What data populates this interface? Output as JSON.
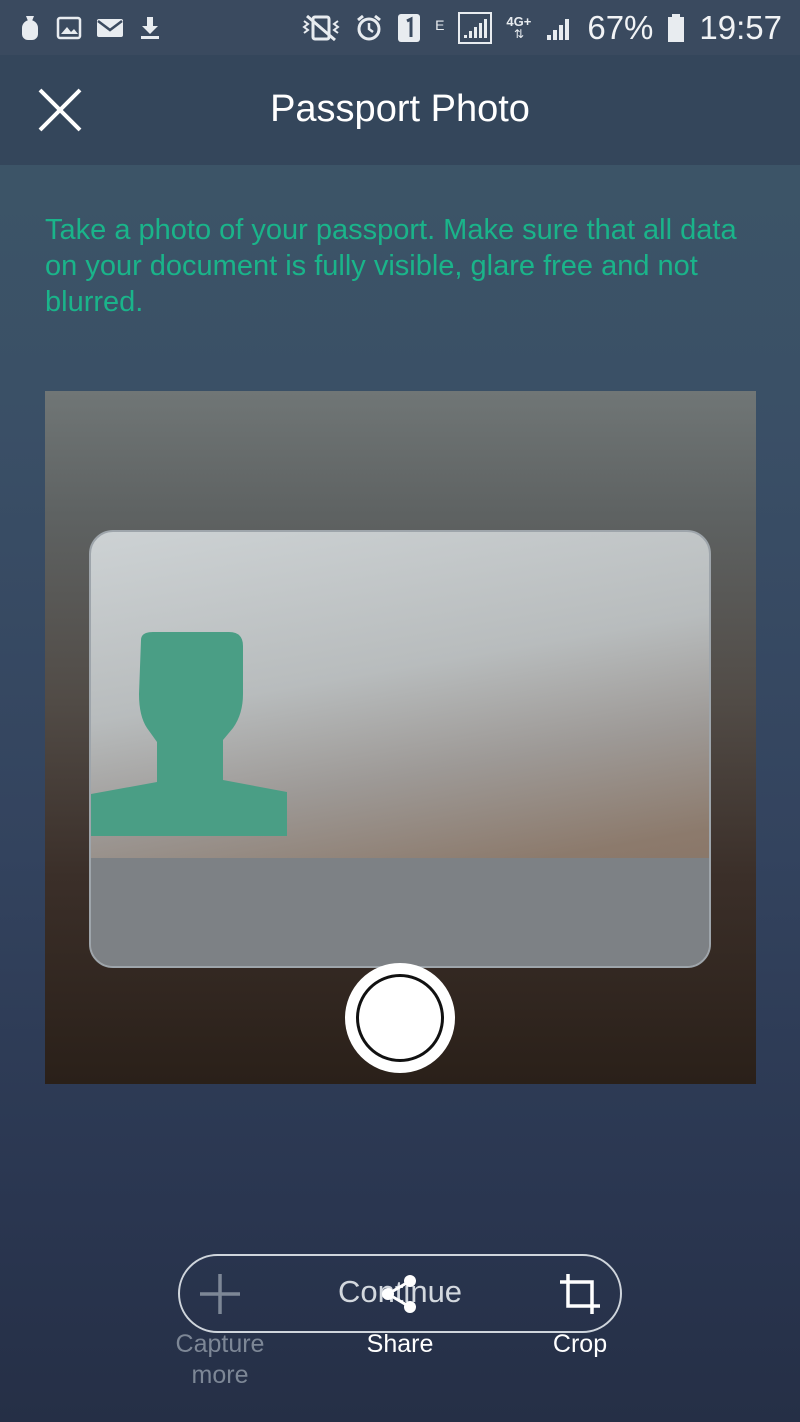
{
  "status_bar": {
    "battery": "67%",
    "time": "19:57",
    "network_e": "E",
    "network_4g": "4G+"
  },
  "header": {
    "title": "Passport Photo"
  },
  "instructions": "Take a photo of your passport. Make sure that all data on your document is fully visible, glare free and not blurred.",
  "actions": {
    "continue_label": "Continue",
    "capture_more_line1": "Capture",
    "capture_more_line2": "more",
    "share_label": "Share",
    "crop_label": "Crop"
  },
  "colors": {
    "accent": "#1ab48a",
    "silhouette": "#4a9e85"
  }
}
